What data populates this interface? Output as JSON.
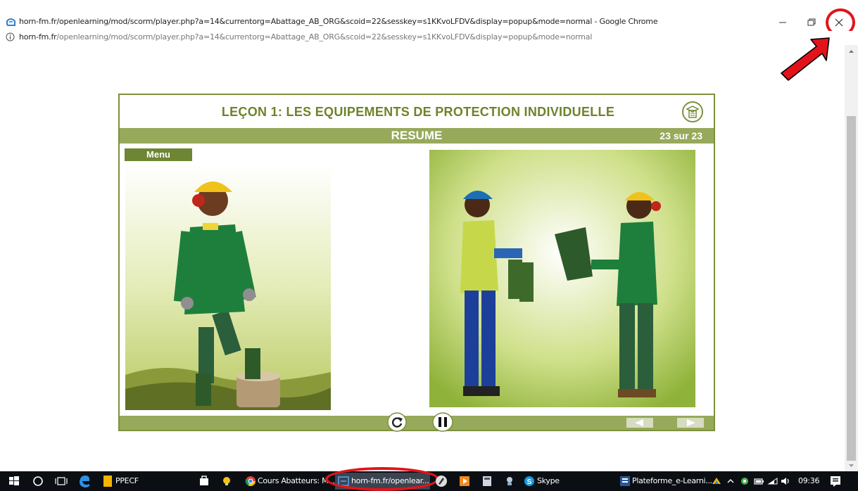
{
  "window": {
    "title": "horn-fm.fr/openlearning/mod/scorm/player.php?a=14&currentorg=Abattage_AB_ORG&scoid=22&sesskey=s1KKvoLFDV&display=popup&mode=normal - Google Chrome",
    "url_host": "horn-fm.fr",
    "url_path": "/openlearning/mod/scorm/player.php?a=14&currentorg=Abattage_AB_ORG&scoid=22&sesskey=s1KKvoLFDV&display=popup&mode=normal",
    "controls": {
      "minimize": "–",
      "restore": "❐",
      "close": "✕"
    }
  },
  "lesson": {
    "title": "LEÇON 1: LES EQUIPEMENTS DE PROTECTION INDIVIDUELLE",
    "section": "RESUME",
    "page_counter": "23 sur 23",
    "menu_label": "Menu"
  },
  "taskbar": {
    "items": [
      {
        "label": "PPECF"
      },
      {
        "label": "Cours Abatteurs: M..."
      },
      {
        "label": "horn-fm.fr/openlear..."
      },
      {
        "label": "Skype"
      },
      {
        "label": "Plateforme_e-Learni..."
      }
    ],
    "clock": "09:36"
  },
  "colors": {
    "player_green": "#97a95b",
    "title_green": "#6d832a",
    "annotation_red": "#e3131b",
    "taskbar": "#0b0f14"
  },
  "icons": [
    "chrome-logo-icon",
    "info-icon",
    "close-icon",
    "replay-icon",
    "pause-icon",
    "arrow-left-icon",
    "arrow-right-icon",
    "windows-start-icon",
    "cortana-icon",
    "task-view-icon",
    "edge-icon",
    "skype-icon"
  ]
}
